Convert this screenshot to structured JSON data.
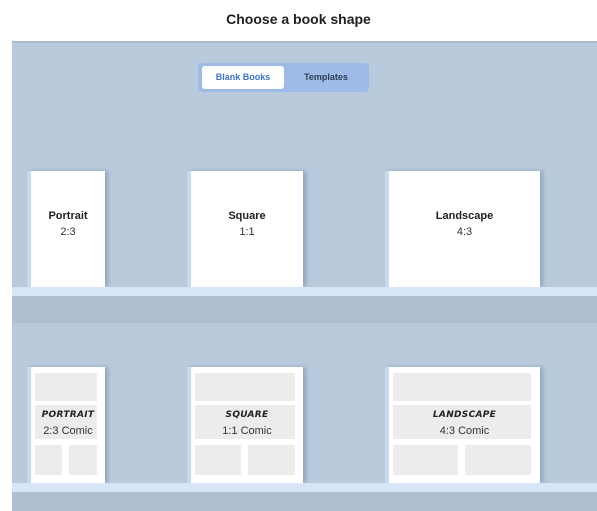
{
  "header": {
    "title": "Choose a book shape"
  },
  "toggle": {
    "blank_books": "Blank Books",
    "templates": "Templates"
  },
  "shelf_top": {
    "books": [
      {
        "name": "Portrait",
        "ratio": "2:3"
      },
      {
        "name": "Square",
        "ratio": "1:1"
      },
      {
        "name": "Landscape",
        "ratio": "4:3"
      }
    ]
  },
  "shelf_bottom": {
    "books": [
      {
        "name": "PORTRAIT",
        "ratio": "2:3 Comic"
      },
      {
        "name": "SQUARE",
        "ratio": "1:1 Comic"
      },
      {
        "name": "LANDSCAPE",
        "ratio": "4:3 Comic"
      }
    ]
  },
  "colors": {
    "shelf_bg": "#b9cadd",
    "toggle_active_text": "#3b73d1",
    "toggle_bg": "#9dbbe6"
  }
}
